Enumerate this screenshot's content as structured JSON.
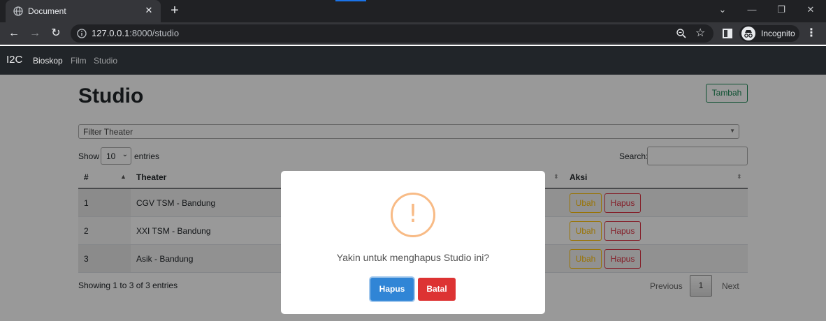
{
  "browser": {
    "tab_title": "Document",
    "tab_close": "✕",
    "new_tab": "+",
    "url_host": "127.0.0.1",
    "url_path": ":8000/studio",
    "incognito_label": "Incognito",
    "window_controls": {
      "collapse": "⌄",
      "minimize": "—",
      "restore": "❐",
      "close": "✕"
    }
  },
  "navbar": {
    "brand": "I2C",
    "links": [
      {
        "label": "Bioskop",
        "active": true
      },
      {
        "label": "Film",
        "active": false
      },
      {
        "label": "Studio",
        "active": false
      }
    ]
  },
  "page": {
    "title": "Studio",
    "add_button": "Tambah",
    "filter_placeholder": "Filter Theater"
  },
  "table_controls": {
    "show_label": "Show",
    "page_length": "10",
    "entries_label": "entries",
    "search_label": "Search:"
  },
  "table": {
    "columns": [
      "#",
      "Theater",
      "Aksi"
    ],
    "rows": [
      {
        "no": "1",
        "theater": "CGV TSM - Bandung",
        "edit": "Ubah",
        "delete": "Hapus"
      },
      {
        "no": "2",
        "theater": "XXI TSM - Bandung",
        "edit": "Ubah",
        "delete": "Hapus"
      },
      {
        "no": "3",
        "theater": "Asik - Bandung",
        "edit": "Ubah",
        "delete": "Hapus"
      }
    ]
  },
  "pagination": {
    "info": "Showing 1 to 3 of 3 entries",
    "previous": "Previous",
    "current_page": "1",
    "next": "Next"
  },
  "modal": {
    "icon": "!",
    "message": "Yakin untuk menghapus Studio ini?",
    "confirm": "Hapus",
    "cancel": "Batal"
  },
  "colors": {
    "browser_bg": "#202124",
    "navbar_bg": "#212529",
    "success": "#198754",
    "warning": "#ffc107",
    "danger": "#dc3545",
    "modal_confirm": "#3085d6",
    "modal_cancel": "#dd3333",
    "warning_icon": "#f8bb86"
  }
}
